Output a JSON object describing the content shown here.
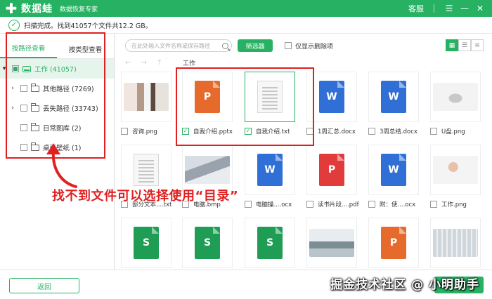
{
  "app": {
    "name": "数据蛙",
    "subtitle": "数据恢复专家",
    "kefu": "客服",
    "window_controls": [
      "☰",
      "—",
      "✕"
    ]
  },
  "status": {
    "text": "扫描完成。找到41057个文件共12.2 GB。"
  },
  "left_panel": {
    "tabs": [
      {
        "label": "按路径查看",
        "active": true
      },
      {
        "label": "按类型查看",
        "active": false
      }
    ],
    "tree": [
      {
        "label": "工作 (41057)",
        "level": 0
      },
      {
        "label": "其他路径 (7269)",
        "level": 1,
        "expandable": true
      },
      {
        "label": "丢失路径 (33743)",
        "level": 1,
        "expandable": true
      },
      {
        "label": "日常图库 (2)",
        "level": 1,
        "expandable": false
      },
      {
        "label": "桌面壁纸 (1)",
        "level": 1,
        "expandable": false
      }
    ]
  },
  "toolbar": {
    "search_placeholder": "在此处输入文件名称或保存路径",
    "filter_label": "筛选器",
    "only_deleted_label": "仅显示删除项"
  },
  "path": {
    "current": "工作"
  },
  "files": [
    {
      "name": "咨询.png",
      "kind": "photo",
      "style": "ph-meeting",
      "checked": false
    },
    {
      "name": "自我介绍.pptx",
      "kind": "ppt",
      "checked": true
    },
    {
      "name": "自我介绍.txt",
      "kind": "txt",
      "checked": true,
      "selected": true
    },
    {
      "name": "1周汇总.docx",
      "kind": "word",
      "checked": false
    },
    {
      "name": "3周总结.docx",
      "kind": "word",
      "checked": false
    },
    {
      "name": "U盘.png",
      "kind": "photo",
      "style": "ph-usb",
      "checked": false
    },
    {
      "name": "部分文本....txt",
      "kind": "txt",
      "checked": false
    },
    {
      "name": "电脑.bmp",
      "kind": "photo",
      "style": "ph-laptop",
      "checked": false
    },
    {
      "name": "电脑操....ocx",
      "kind": "word",
      "checked": false
    },
    {
      "name": "读书片段....pdf",
      "kind": "pdf",
      "checked": false
    },
    {
      "name": "附：使....ocx",
      "kind": "word",
      "checked": false
    },
    {
      "name": "工作.png",
      "kind": "photo",
      "style": "ph-girl",
      "checked": false
    },
    {
      "name": "",
      "kind": "xls",
      "checked": false
    },
    {
      "name": "",
      "kind": "xls",
      "checked": false
    },
    {
      "name": "",
      "kind": "xls",
      "checked": false
    },
    {
      "name": "",
      "kind": "photo",
      "style": "ph-land",
      "checked": false
    },
    {
      "name": "",
      "kind": "ppt",
      "checked": false
    },
    {
      "name": "",
      "kind": "photo",
      "style": "ph-keyboard",
      "checked": false
    }
  ],
  "icon_letters": {
    "ppt": "P",
    "word": "W",
    "xls": "S",
    "pdf": "P"
  },
  "bottom": {
    "back_label": "返回",
    "watermark": "掘金技术社区 @ 小明助手"
  },
  "annotation": {
    "text": "找不到文件可以选择使用“目录”"
  },
  "colors": {
    "brand": "#27b263",
    "annotation": "#e02020"
  }
}
